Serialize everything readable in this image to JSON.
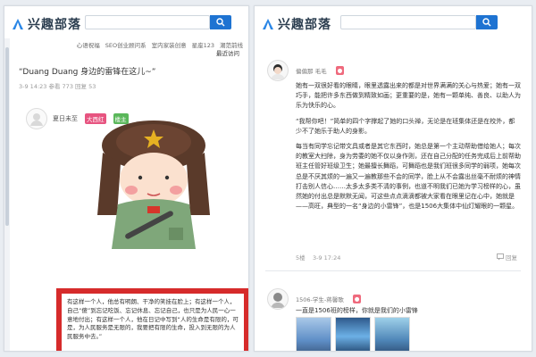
{
  "left": {
    "logo_text": "兴趣部落",
    "search": {
      "placeholder": ""
    },
    "nav": [
      "心语祝福",
      "SEO创业顾问系",
      "室内家装创意",
      "星座123",
      "潮范前线"
    ],
    "sidebar_peek": "最近访问",
    "post_title": "“Duang Duang 身边的雷锋在这儿~”",
    "post_meta": "3-9 14:23   参看 773   回复 53",
    "author": {
      "name": "夏日未至",
      "badges": [
        "大西红",
        "楼主"
      ]
    },
    "card_text": "有这样一个人，他总有明朗、干净的笑挂在脸上；有这样一个人，自己“傻”到忘记吃饭、忘记休息、忘记自己，也只是为人民一心一意地付出；有这样一个人，他在日记中写到“人的生命是有限的，可是，为人民服务是无限的，我要把有限的生命，投入到无限的为人民服务中去。”"
  },
  "right": {
    "logo_text": "兴趣部落",
    "search": {
      "placeholder": ""
    },
    "post1": {
      "author": "偏偏那   毛毛",
      "badge": "●",
      "paragraphs": [
        "她有一双很好看的眼睛，眼里透露出来的都是对世界满满的关心与热爱；她有一双巧手，能把许多东西做到精致如画；更重要的是，她有一颗单纯、善良、以助人为乐为快乐的心。",
        "“我帮你吧！”简单的四个字撑起了她的口头禅，无论是在班集体还是在校外，都少不了她乐于助人的身影。",
        "每当有同学忘记带文具或者是其它东西时，她总是第一个主动帮助借给她人；每次的教室大扫除，身为劳委的她不仅以身作则，还在自己分配的任务完成后上前帮助班主任管好班级卫生；她最擅长舞蹈，可舞蹈也是我们班很多同学的弱项，她每次总是不厌其烦的一遍又一遍教那些不会的同学，脸上从不会露出丝毫不耐烦的神情打击别人信心……太多太多类不清的事例，也道不明我们已她为学习榜样的心，虽然她的付出总是默默无闻，可这些点点滴滴都被大家看在眼里记在心中，她就是——高旺，典型的一名“身边的小雷锋”，也是1506大集体中仙灯耀眼的一颗星。"
      ],
      "floor": "5楼",
      "time": "3-9 17:24",
      "reply_label": "回复"
    },
    "post2": {
      "author": "1506-学生-蒋馨歌",
      "badge": "●",
      "text": "一直是1506班的榜样，你就是我们的小雷锋"
    }
  }
}
